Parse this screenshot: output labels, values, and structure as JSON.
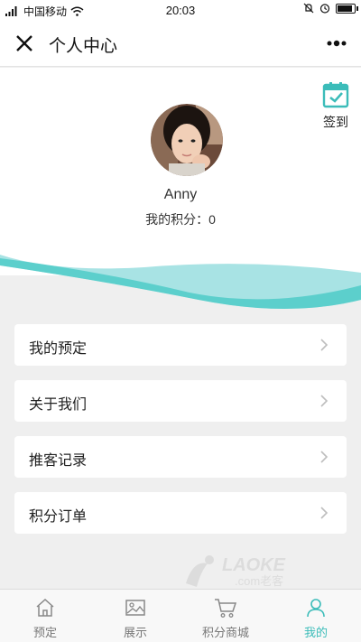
{
  "status_bar": {
    "carrier": "中国移动",
    "time": "20:03"
  },
  "nav": {
    "title": "个人中心"
  },
  "checkin": {
    "label": "签到"
  },
  "profile": {
    "name": "Anny",
    "points_text": "我的积分：0"
  },
  "menu": [
    {
      "label": "我的预定"
    },
    {
      "label": "关于我们"
    },
    {
      "label": "推客记录"
    },
    {
      "label": "积分订单"
    }
  ],
  "watermark": {
    "text": "LAOKE",
    "subtext": ".com老客"
  },
  "tabs": [
    {
      "label": "预定",
      "icon": "home-icon",
      "active": false
    },
    {
      "label": "展示",
      "icon": "image-icon",
      "active": false
    },
    {
      "label": "积分商城",
      "icon": "cart-icon",
      "active": false
    },
    {
      "label": "我的",
      "icon": "user-icon",
      "active": true
    }
  ],
  "colors": {
    "accent": "#3bbcb9",
    "wave_light": "#a8e3e4",
    "background": "#efefef"
  }
}
